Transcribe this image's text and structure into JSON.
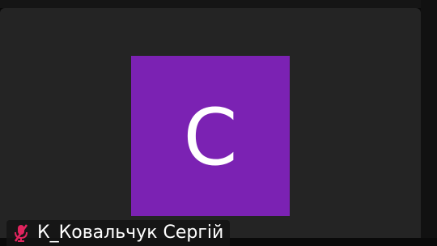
{
  "participant": {
    "initial": "C",
    "name": "К_Ковальчук Сергій",
    "mic_icon": "microphone-muted-icon",
    "avatar_color": "#7b22b3",
    "mic_muted_color": "#e0245e"
  }
}
